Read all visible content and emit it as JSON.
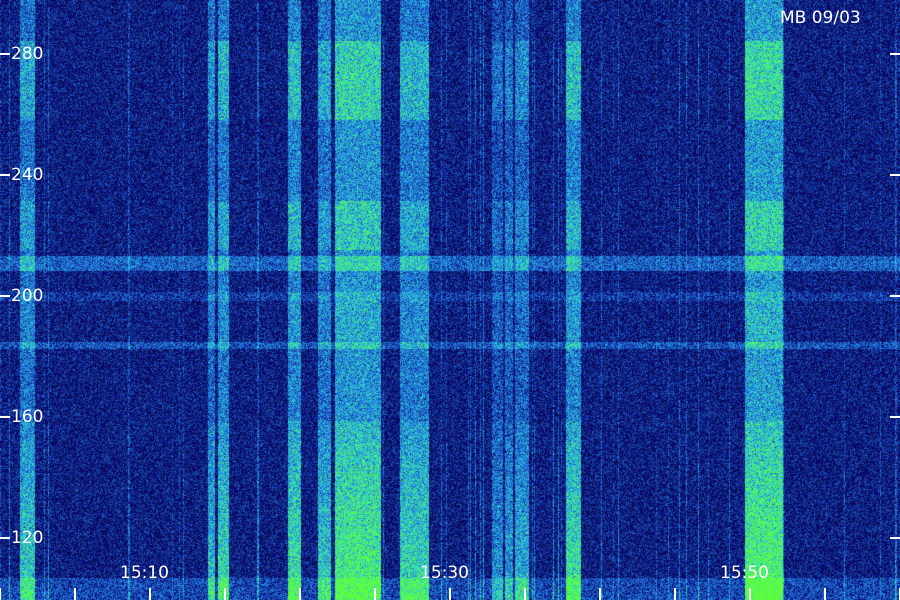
{
  "chart_data": {
    "type": "heatmap",
    "title": "MB 09/03",
    "y_ticks": [
      "120",
      "160",
      "200",
      "240",
      "280"
    ],
    "x_ticks": [
      "15:10",
      "15:30",
      "15:50"
    ],
    "colors": {
      "background": "#0a0a4a",
      "mid": "#1f5fd9",
      "high": "#2fd0d6",
      "peak": "#5cff3a"
    }
  }
}
